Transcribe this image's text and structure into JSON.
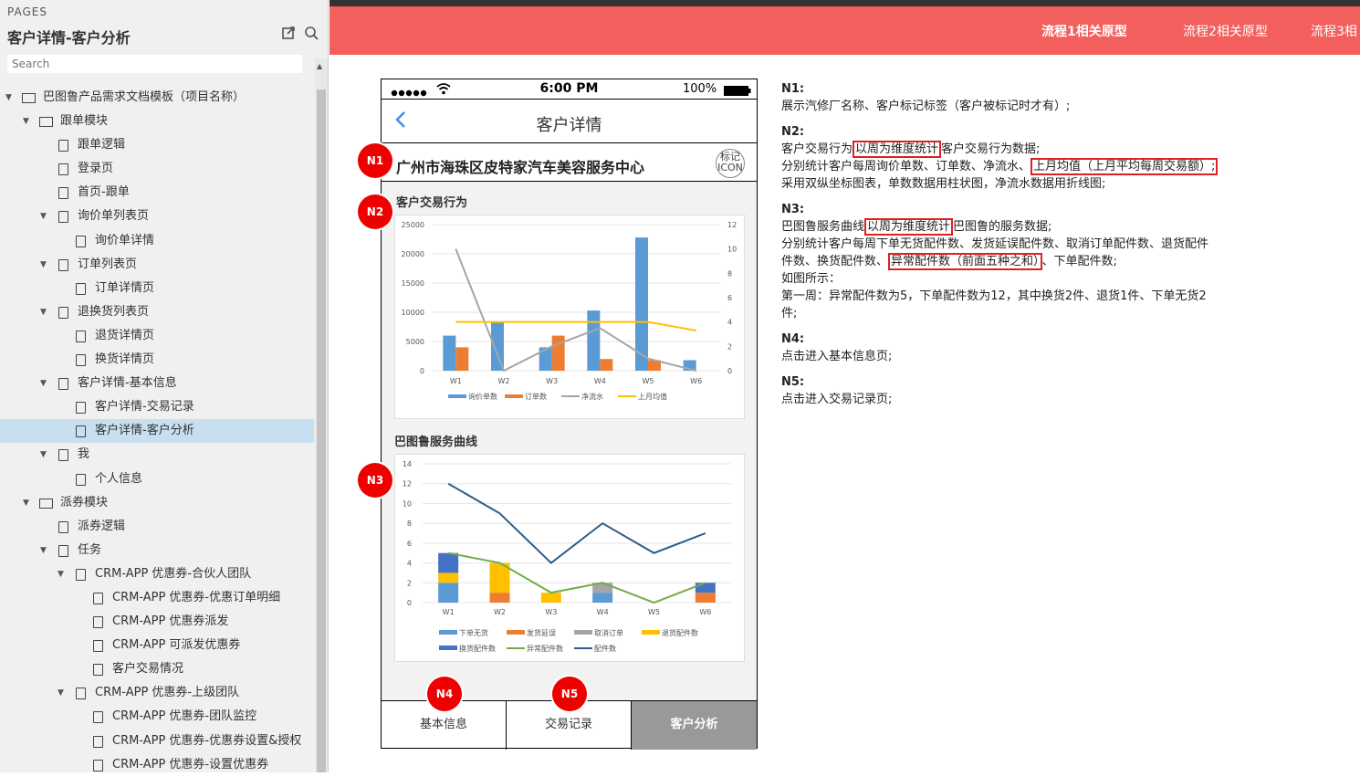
{
  "sidebar": {
    "pages_label": "PAGES",
    "title": "客户详情-客户分析",
    "search_placeholder": "Search",
    "tree": [
      {
        "label": "巴图鲁产品需求文档模板（项目名称）",
        "level": 0,
        "type": "folder",
        "expanded": true
      },
      {
        "label": "跟单模块",
        "level": 1,
        "type": "folder",
        "expanded": true
      },
      {
        "label": "跟单逻辑",
        "level": 2,
        "type": "page"
      },
      {
        "label": "登录页",
        "level": 2,
        "type": "page"
      },
      {
        "label": "首页-跟单",
        "level": 2,
        "type": "page"
      },
      {
        "label": "询价单列表页",
        "level": 2,
        "type": "page",
        "expanded": true
      },
      {
        "label": "询价单详情",
        "level": 3,
        "type": "page"
      },
      {
        "label": "订单列表页",
        "level": 2,
        "type": "page",
        "expanded": true
      },
      {
        "label": "订单详情页",
        "level": 3,
        "type": "page"
      },
      {
        "label": "退换货列表页",
        "level": 2,
        "type": "page",
        "expanded": true
      },
      {
        "label": "退货详情页",
        "level": 3,
        "type": "page"
      },
      {
        "label": "换货详情页",
        "level": 3,
        "type": "page"
      },
      {
        "label": "客户详情-基本信息",
        "level": 2,
        "type": "page",
        "expanded": true
      },
      {
        "label": "客户详情-交易记录",
        "level": 3,
        "type": "page"
      },
      {
        "label": "客户详情-客户分析",
        "level": 3,
        "type": "page",
        "selected": true
      },
      {
        "label": "我",
        "level": 2,
        "type": "page",
        "expanded": true
      },
      {
        "label": "个人信息",
        "level": 3,
        "type": "page"
      },
      {
        "label": "派券模块",
        "level": 1,
        "type": "folder",
        "expanded": true
      },
      {
        "label": "派券逻辑",
        "level": 2,
        "type": "page"
      },
      {
        "label": "任务",
        "level": 2,
        "type": "page",
        "expanded": true
      },
      {
        "label": "CRM-APP 优惠券-合伙人团队",
        "level": 3,
        "type": "page",
        "expanded": true
      },
      {
        "label": "CRM-APP 优惠券-优惠订单明细",
        "level": 4,
        "type": "page"
      },
      {
        "label": "CRM-APP 优惠券派发",
        "level": 4,
        "type": "page"
      },
      {
        "label": "CRM-APP 可派发优惠券",
        "level": 4,
        "type": "page"
      },
      {
        "label": "客户交易情况",
        "level": 4,
        "type": "page"
      },
      {
        "label": "CRM-APP 优惠券-上级团队",
        "level": 3,
        "type": "page",
        "expanded": true
      },
      {
        "label": "CRM-APP 优惠券-团队监控",
        "level": 4,
        "type": "page"
      },
      {
        "label": "CRM-APP 优惠券-优惠券设置&授权",
        "level": 4,
        "type": "page"
      },
      {
        "label": "CRM-APP 优惠券-设置优惠券",
        "level": 4,
        "type": "page"
      }
    ]
  },
  "topbar": {
    "tabs": [
      {
        "label": "流程1相关原型",
        "active": true
      },
      {
        "label": "流程2相关原型",
        "active": false
      },
      {
        "label": "流程3相",
        "active": false
      }
    ],
    "color": "#f25f5c"
  },
  "phone": {
    "status": {
      "time": "6:00 PM",
      "battery": "100%"
    },
    "nav_title": "客户详情",
    "shop_name": "广州市海珠区皮特家汽车美容服务中心",
    "tag_icon_text": "标记ICON",
    "chart1_title": "客户交易行为",
    "chart2_title": "巴图鲁服务曲线",
    "tabbar": [
      {
        "label": "基本信息",
        "active": false
      },
      {
        "label": "交易记录",
        "active": false
      },
      {
        "label": "客户分析",
        "active": true
      }
    ]
  },
  "badges": {
    "n1": "N1",
    "n2": "N2",
    "n3": "N3",
    "n4": "N4",
    "n5": "N5"
  },
  "chart_data": [
    {
      "type": "bar",
      "title": "客户交易行为",
      "categories": [
        "W1",
        "W2",
        "W3",
        "W4",
        "W5",
        "W6"
      ],
      "ylim": [
        0,
        25000
      ],
      "yticks": [
        0,
        5000,
        10000,
        15000,
        20000,
        25000
      ],
      "y2lim": [
        0,
        12
      ],
      "y2ticks": [
        0,
        2,
        4,
        6,
        8,
        10,
        12
      ],
      "series": [
        {
          "name": "询价单数",
          "type": "bar",
          "axis": "left",
          "color": "#5b9bd5",
          "values": [
            6000,
            8200,
            4000,
            10300,
            22800,
            1800
          ]
        },
        {
          "name": "订单数",
          "type": "bar",
          "axis": "left",
          "color": "#ed7d31",
          "values": [
            4000,
            0,
            6000,
            2000,
            1800,
            0
          ]
        },
        {
          "name": "净流水",
          "type": "line",
          "axis": "right",
          "color": "#a5a5a5",
          "values": [
            10,
            0,
            2,
            3.5,
            1,
            0
          ]
        },
        {
          "name": "上月均值",
          "type": "line",
          "axis": "right",
          "color": "#ffc000",
          "values": [
            4,
            4,
            4,
            4,
            4,
            3.3
          ]
        }
      ]
    },
    {
      "type": "bar",
      "title": "巴图鲁服务曲线",
      "stacked": true,
      "categories": [
        "W1",
        "W2",
        "W3",
        "W4",
        "W5",
        "W6"
      ],
      "ylim": [
        0,
        14
      ],
      "yticks": [
        0,
        2,
        4,
        6,
        8,
        10,
        12,
        14
      ],
      "series": [
        {
          "name": "下单无货",
          "type": "bar",
          "color": "#5b9bd5",
          "values": [
            2,
            0,
            0,
            1,
            0,
            0
          ]
        },
        {
          "name": "发货延误",
          "type": "bar",
          "color": "#ed7d31",
          "values": [
            0,
            1,
            0,
            0,
            0,
            1
          ]
        },
        {
          "name": "取消订单",
          "type": "bar",
          "color": "#a5a5a5",
          "values": [
            0,
            0,
            0,
            1,
            0,
            0
          ]
        },
        {
          "name": "退货配件数",
          "type": "bar",
          "color": "#ffc000",
          "values": [
            1,
            3,
            1,
            0,
            0,
            0
          ]
        },
        {
          "name": "换货配件数",
          "type": "bar",
          "color": "#4472c4",
          "values": [
            2,
            0,
            0,
            0,
            0,
            1
          ]
        },
        {
          "name": "异常配件数",
          "type": "line",
          "color": "#70ad47",
          "values": [
            5,
            4,
            1,
            2,
            0,
            2
          ]
        },
        {
          "name": "配件数",
          "type": "line",
          "color": "#2e5b8a",
          "values": [
            12,
            9,
            4,
            8,
            5,
            7
          ]
        }
      ]
    }
  ],
  "notes": [
    {
      "head": "N1:",
      "lines": [
        [
          {
            "t": "展示汽修厂名称、客户标记标签（客户被标记时才有）;"
          }
        ]
      ]
    },
    {
      "head": "N2:",
      "lines": [
        [
          {
            "t": "客户交易行为"
          },
          {
            "t": "以周为维度统计",
            "hl": true
          },
          {
            "t": "客户交易行为数据;"
          }
        ],
        [
          {
            "t": "分别统计客户每周询价单数、订单数、净流水、"
          },
          {
            "t": "上月均值（上月平均每周交易额）;",
            "hl": true
          }
        ],
        [
          {
            "t": "采用双纵坐标图表，单数数据用柱状图，净流水数据用折线图;"
          }
        ]
      ]
    },
    {
      "head": "N3:",
      "lines": [
        [
          {
            "t": "巴图鲁服务曲线"
          },
          {
            "t": "以周为维度统计",
            "hl": true
          },
          {
            "t": "巴图鲁的服务数据;"
          }
        ],
        [
          {
            "t": "分别统计客户每周下单无货配件数、发货延误配件数、取消订单配件数、退货配件"
          }
        ],
        [
          {
            "t": "件数、换货配件数、"
          },
          {
            "t": "异常配件数（前面五种之和）",
            "hl": true
          },
          {
            "t": "、下单配件数;"
          }
        ],
        [
          {
            "t": "如图所示："
          }
        ],
        [
          {
            "t": "第一周：异常配件数为5，下单配件数为12，其中换货2件、退货1件、下单无货2"
          }
        ],
        [
          {
            "t": "件;"
          }
        ]
      ]
    },
    {
      "head": "N4:",
      "lines": [
        [
          {
            "t": "点击进入基本信息页;"
          }
        ]
      ]
    },
    {
      "head": "N5:",
      "lines": [
        [
          {
            "t": "点击进入交易记录页;"
          }
        ]
      ]
    }
  ]
}
